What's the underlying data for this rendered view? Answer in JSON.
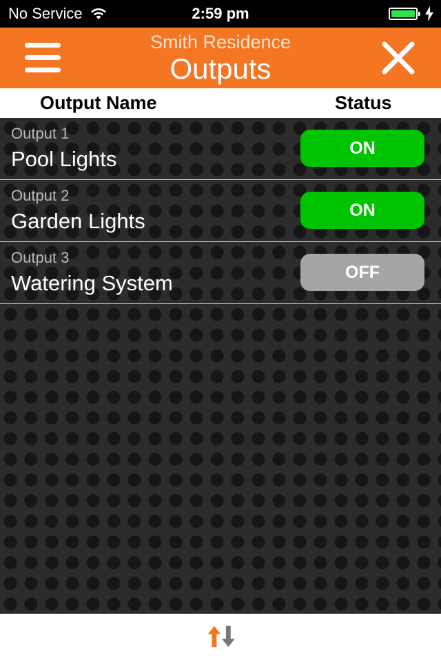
{
  "status_bar": {
    "carrier": "No Service",
    "time": "2:59 pm",
    "icons": [
      "wifi-icon",
      "battery-icon",
      "charging-icon"
    ]
  },
  "nav": {
    "subtitle": "Smith Residence",
    "title": "Outputs",
    "menu_icon": "hamburger-menu-icon",
    "close_icon": "close-icon"
  },
  "table": {
    "headers": {
      "name": "Output Name",
      "status": "Status"
    },
    "rows": [
      {
        "number": "Output 1",
        "name": "Pool Lights",
        "status": "ON"
      },
      {
        "number": "Output 2",
        "name": "Garden Lights",
        "status": "ON"
      },
      {
        "number": "Output 3",
        "name": "Watering System",
        "status": "OFF"
      }
    ]
  },
  "toolbar": {
    "icon": "up-down-arrows-icon"
  },
  "colors": {
    "accent": "#f47522",
    "on": "#00c400",
    "off": "#a5a5a5",
    "arrow_up": "#f47522",
    "arrow_down": "#777777"
  }
}
